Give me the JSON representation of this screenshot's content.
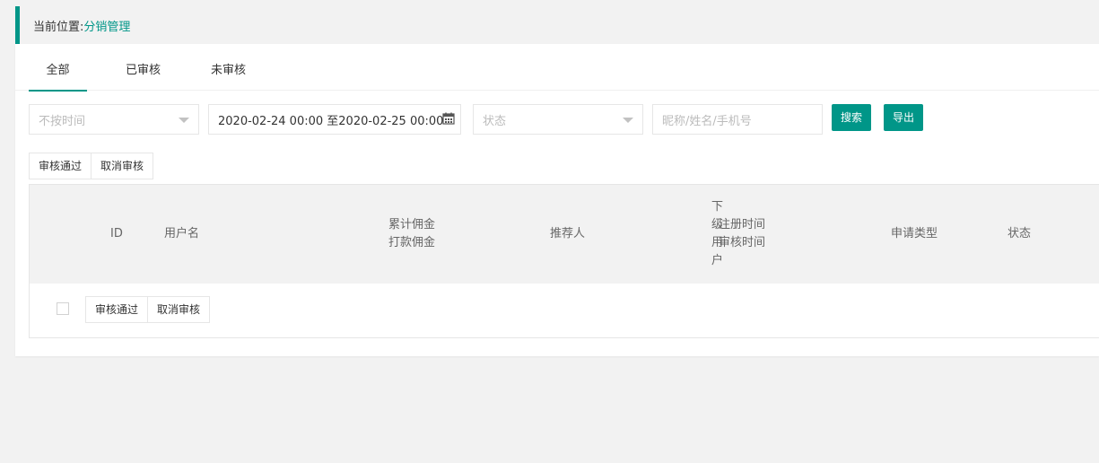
{
  "breadcrumb": {
    "label": "当前位置:",
    "current": "分销管理"
  },
  "tabs": [
    {
      "label": "全部",
      "active": true
    },
    {
      "label": "已审核",
      "active": false
    },
    {
      "label": "未审核",
      "active": false
    }
  ],
  "filters": {
    "time_select": {
      "placeholder": "不按时间"
    },
    "date_range": {
      "value": "2020-02-24 00:00 至2020-02-25 00:00"
    },
    "status_select": {
      "placeholder": "状态"
    },
    "keyword_input": {
      "placeholder": "昵称/姓名/手机号"
    },
    "search_label": "搜索",
    "export_label": "导出"
  },
  "bulk_actions": {
    "approve_label": "审核通过",
    "cancel_label": "取消审核"
  },
  "table": {
    "headers": {
      "id": "ID",
      "username": "用户名",
      "commission_total": "累计佣金",
      "commission_paid": "打款佣金",
      "referrer": "推荐人",
      "subordinate": "下级用户",
      "register_time": "注册时间",
      "review_time": "审核时间",
      "apply_type": "申请类型",
      "status": "状态"
    }
  },
  "footer_actions": {
    "approve_label": "审核通过",
    "cancel_label": "取消审核"
  },
  "colors": {
    "accent": "#009688"
  }
}
